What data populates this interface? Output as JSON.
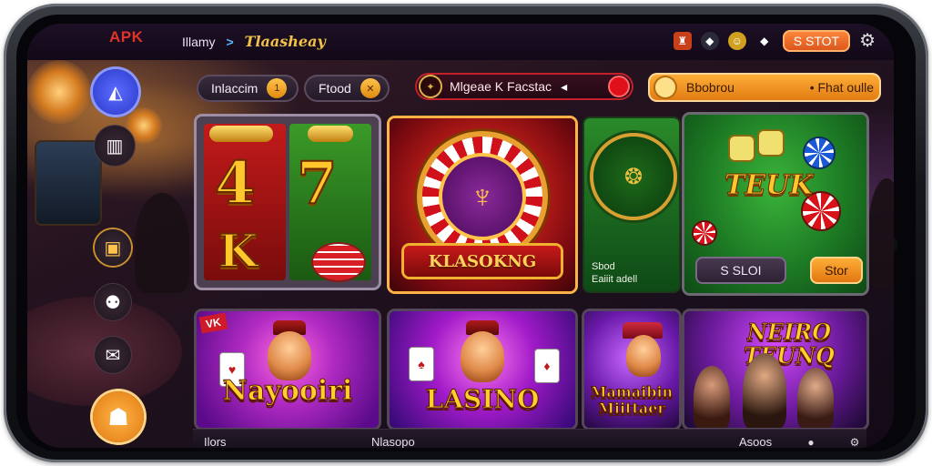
{
  "header": {
    "logo_text": "APK",
    "breadcrumb_home": "Illamy",
    "breadcrumb_title": "Tlaasheay",
    "slot_button_label": "S STOT"
  },
  "filters": {
    "pill_1": "Inlaccim",
    "pill_2": "Ftood",
    "feature_pill": "Mlgeae K Facstac",
    "wide_button_left": "Bbobrou",
    "wide_button_right": "• Fhat oulle"
  },
  "tiles": {
    "wheel_banner": "KLASOKNG",
    "green_tile_line1": "Sbod",
    "green_tile_line2": "Eaiiit adell",
    "table_title": "TEUK",
    "table_button_dark": "S SLOI",
    "table_button_orange": "Stor"
  },
  "cards": {
    "card1_tag": "VK",
    "card1_title": "Nayooiri",
    "card2_title": "LASINO",
    "card3_title_line1": "Mamaibin",
    "card3_title_line2": "Miittaer",
    "card4_title_line1": "NEIRO",
    "card4_title_line2": "TEUNQ"
  },
  "bottom_bar": {
    "left_label": "Ilors",
    "center_label": "Nlasopo",
    "right_label": "Asoos"
  },
  "colors": {
    "accent_orange": "#e07810",
    "accent_gold": "#ffc72c",
    "brand_red": "#e0342a",
    "primary_blue": "#3a4ad9"
  }
}
